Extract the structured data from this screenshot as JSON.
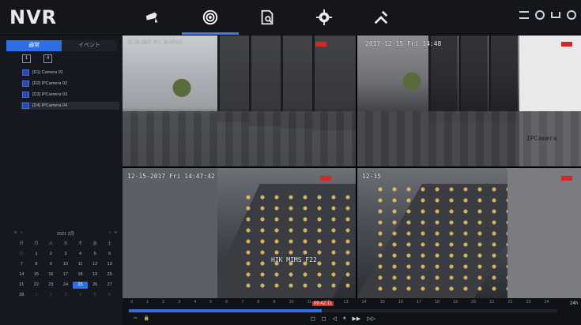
{
  "app": {
    "brand": "NVR"
  },
  "nav": {
    "items": [
      {
        "name": "live-view",
        "icon": "camera-icon"
      },
      {
        "name": "playback",
        "icon": "playback-icon"
      },
      {
        "name": "search",
        "icon": "file-search-icon"
      },
      {
        "name": "settings",
        "icon": "gear-icon"
      },
      {
        "name": "maintenance",
        "icon": "tools-icon"
      }
    ],
    "active": "playback"
  },
  "sidebar": {
    "tabs": [
      {
        "label": "通常"
      },
      {
        "label": "イベント"
      }
    ],
    "square_buttons": [
      "1",
      "4"
    ],
    "cameras": [
      {
        "label": "[D1] Camera 01"
      },
      {
        "label": "[D2] IPCamera 02"
      },
      {
        "label": "[D3] IPCamera 03"
      },
      {
        "label": "[D4] IPCamera 04"
      }
    ],
    "calendar": {
      "month_label": "2021 2月",
      "weekdays": [
        "日",
        "月",
        "火",
        "水",
        "木",
        "金",
        "土"
      ],
      "days": [
        {
          "d": "31",
          "dim": true
        },
        {
          "d": "1"
        },
        {
          "d": "2"
        },
        {
          "d": "3"
        },
        {
          "d": "4"
        },
        {
          "d": "5"
        },
        {
          "d": "6"
        },
        {
          "d": "7"
        },
        {
          "d": "8"
        },
        {
          "d": "9"
        },
        {
          "d": "10"
        },
        {
          "d": "11"
        },
        {
          "d": "12"
        },
        {
          "d": "13"
        },
        {
          "d": "14"
        },
        {
          "d": "15"
        },
        {
          "d": "16"
        },
        {
          "d": "17"
        },
        {
          "d": "18"
        },
        {
          "d": "19"
        },
        {
          "d": "20"
        },
        {
          "d": "21"
        },
        {
          "d": "22"
        },
        {
          "d": "23"
        },
        {
          "d": "24"
        },
        {
          "d": "25",
          "sel": true
        },
        {
          "d": "26"
        },
        {
          "d": "27"
        },
        {
          "d": "28"
        },
        {
          "d": "1",
          "dim": true
        },
        {
          "d": "2",
          "dim": true
        },
        {
          "d": "3",
          "dim": true
        },
        {
          "d": "4",
          "dim": true
        },
        {
          "d": "5",
          "dim": true
        },
        {
          "d": "6",
          "dim": true
        }
      ]
    }
  },
  "tiles": [
    {
      "osd_top": "12-15-2017 Fri 14:47:41",
      "osd_bottom": ""
    },
    {
      "osd_top": "2017-12-15 Fri 14:48",
      "osd_bottom": "IPCamera"
    },
    {
      "osd_top": "12-15-2017 Fri 14:47:42",
      "osd_bottom": "HIK MIMS F22"
    },
    {
      "osd_top": "12-15",
      "osd_bottom": ""
    }
  ],
  "timeline": {
    "ticks": [
      "0",
      "1",
      "2",
      "3",
      "4",
      "5",
      "6",
      "7",
      "8",
      "9",
      "10",
      "11",
      "12",
      "13",
      "14",
      "15",
      "16",
      "17",
      "18",
      "19",
      "20",
      "21",
      "22",
      "23",
      "24"
    ],
    "current_time": "09:42:11",
    "zoom_label": "24h",
    "progress_fraction": 0.45,
    "controls": [
      "◻",
      "◻",
      "◁",
      "⏸",
      "▶▶",
      "▷▷"
    ]
  },
  "colors": {
    "accent": "#2f6fe6",
    "record": "#d12828"
  }
}
